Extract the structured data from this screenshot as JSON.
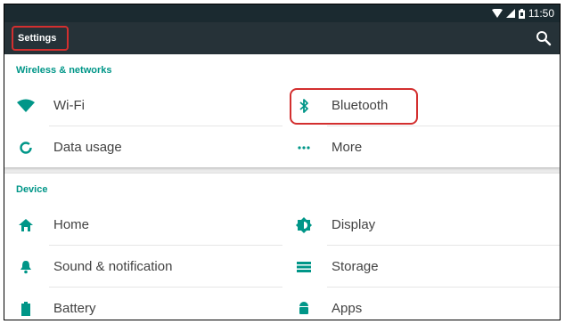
{
  "status_bar": {
    "time": "11:50"
  },
  "toolbar": {
    "title": "Settings",
    "search_icon": "search-icon"
  },
  "sections": [
    {
      "title": "Wireless & networks",
      "items": [
        {
          "label": "Wi-Fi",
          "icon": "wifi-icon"
        },
        {
          "label": "Bluetooth",
          "icon": "bluetooth-icon"
        },
        {
          "label": "Data usage",
          "icon": "data-usage-icon"
        },
        {
          "label": "More",
          "icon": "more-icon"
        }
      ]
    },
    {
      "title": "Device",
      "items": [
        {
          "label": "Home",
          "icon": "home-icon"
        },
        {
          "label": "Display",
          "icon": "display-icon"
        },
        {
          "label": "Sound & notification",
          "icon": "bell-icon"
        },
        {
          "label": "Storage",
          "icon": "storage-icon"
        },
        {
          "label": "Battery",
          "icon": "battery-icon"
        },
        {
          "label": "Apps",
          "icon": "android-icon"
        }
      ]
    }
  ],
  "colors": {
    "accent": "#009688",
    "toolbar": "#263238",
    "status_bar": "#1b2a30",
    "highlight": "#d32f2f"
  }
}
